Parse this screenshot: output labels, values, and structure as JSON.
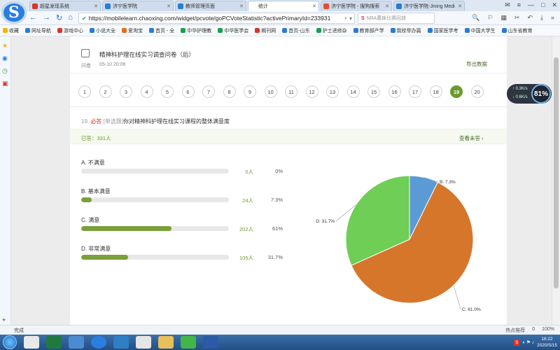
{
  "browser": {
    "logo_letter": "S",
    "tabs": [
      {
        "label": "超星发现系统",
        "color": "#d9352a",
        "active": false
      },
      {
        "label": "济宁医学院",
        "color": "#2b7bd6",
        "active": false
      },
      {
        "label": "教师管理页面",
        "color": "#2b7bd6",
        "active": false
      },
      {
        "label": "统计",
        "color": "#ffffff",
        "active": true
      },
      {
        "label": "济宁医学院 - 搜狗搜索",
        "color": "#e84b2f",
        "active": false
      },
      {
        "label": "济宁医学院-Jining Medi",
        "color": "#2b7bd6",
        "active": false
      }
    ],
    "url": "https://mobilelearn.chaoxing.com/widget/pcvote/goPCVoteStatistic?activePrimaryId=233931",
    "search_placeholder": "NBA惠妹比赛回放",
    "bookmarks": [
      "收藏",
      "网址导航",
      "游戏中心",
      "小说大全",
      "爱淘宝",
      "首页 - 全",
      "中华护理教",
      "中华医学会",
      "期刊网",
      "首页-山东",
      "护士进修杂",
      "教育部产学",
      "我校举办篇",
      "国家医学考",
      "中国大学生",
      "山东省教育"
    ],
    "status_left": "完成",
    "status_right": [
      "热点推荐",
      "0",
      "100%"
    ],
    "clock_time": "16:22",
    "clock_date": "2020/5/15",
    "speed_up": "0.3K/s",
    "speed_down": "0.6K/s",
    "speed_percent": "81%"
  },
  "page": {
    "title": "精神科护理在线实习调查问卷（后）",
    "type_label": "问卷",
    "datetime": "05-10 20:06",
    "export_label": "导出数据",
    "numbers": [
      "1",
      "2",
      "3",
      "4",
      "5",
      "6",
      "7",
      "8",
      "9",
      "10",
      "11",
      "12",
      "13",
      "14",
      "15",
      "16",
      "17",
      "18",
      "19",
      "20"
    ],
    "active_number": "19",
    "question": {
      "number": "19.",
      "required": "必答",
      "qtype": "[单选题]",
      "text": "你对精神科护理在线实习课程的整体满意度"
    },
    "answered_label": "已答：331人",
    "view_unanswered": "查看未答 ›",
    "options": [
      {
        "label": "A. 不满意",
        "count": "0人",
        "pct": "0%",
        "fill": 0.0
      },
      {
        "label": "B. 基本满意",
        "count": "24人",
        "pct": "7.3%",
        "fill": 0.073
      },
      {
        "label": "C. 满意",
        "count": "202人",
        "pct": "61%",
        "fill": 0.61
      },
      {
        "label": "D. 非常满意",
        "count": "105人",
        "pct": "31.7%",
        "fill": 0.317
      }
    ]
  },
  "chart_data": {
    "type": "pie",
    "slices": [
      {
        "label": "B: 7.3%",
        "value": 7.3,
        "color": "#5b9bd5"
      },
      {
        "label": "C: 61.0%",
        "value": 61.0,
        "color": "#d6762b"
      },
      {
        "label": "D: 31.7%",
        "value": 31.7,
        "color": "#6fce55"
      }
    ]
  }
}
